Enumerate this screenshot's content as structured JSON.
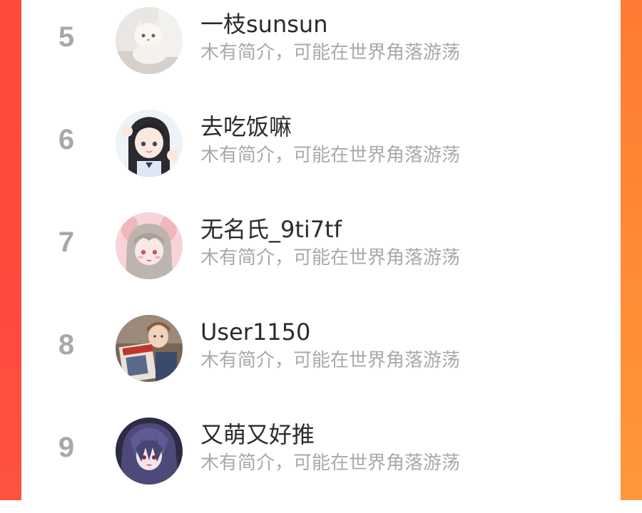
{
  "theme": {
    "accent_left": "#ff4a3a",
    "accent_right": "#ff8a35",
    "rank_color": "#a8a8a8",
    "name_color": "#2b2b2b",
    "bio_color": "#a9a9a9"
  },
  "list": {
    "items": [
      {
        "rank": "5",
        "name": "一枝sunsun",
        "bio": "木有简介，可能在世界角落游荡",
        "avatar": "cat-photo"
      },
      {
        "rank": "6",
        "name": "去吃饭嘛",
        "bio": "木有简介，可能在世界角落游荡",
        "avatar": "anime-girl-dark-hair"
      },
      {
        "rank": "7",
        "name": "无名氏_9ti7tf",
        "bio": "木有简介，可能在世界角落游荡",
        "avatar": "anime-girl-pink-ears"
      },
      {
        "rank": "8",
        "name": "User1150",
        "bio": "木有简介，可能在世界角落游荡",
        "avatar": "boy-reading-magazine"
      },
      {
        "rank": "9",
        "name": "又萌又好推",
        "bio": "木有简介，可能在世界角落游荡",
        "avatar": "anime-girl-purple-hair"
      }
    ]
  }
}
